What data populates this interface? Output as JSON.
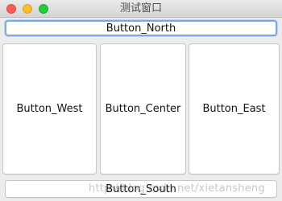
{
  "window": {
    "title": "测试窗口"
  },
  "buttons": {
    "north": "Button_North",
    "west": "Button_West",
    "center": "Button_Center",
    "east": "Button_East",
    "south": "Button_South"
  },
  "watermark": "http://blog.csdn.net/xietansheng",
  "colors": {
    "close": "#fc5f57",
    "minimize": "#fdbc2e",
    "zoom": "#28c840",
    "focus_ring": "#7aa7e8"
  }
}
